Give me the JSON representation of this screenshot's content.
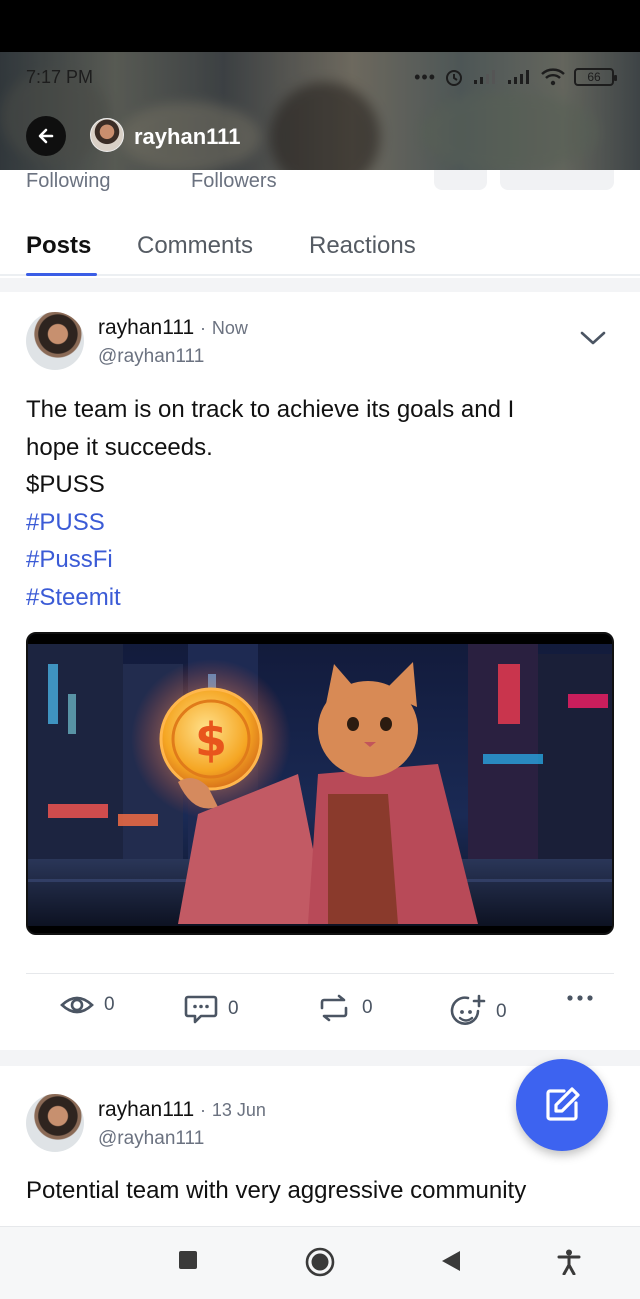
{
  "status_bar": {
    "time": "7:17 PM",
    "battery": "66"
  },
  "header": {
    "username": "rayhan111"
  },
  "profile_stats": {
    "following_label": "Following",
    "followers_label": "Followers"
  },
  "tabs": [
    {
      "label": "Posts",
      "active": true
    },
    {
      "label": "Comments",
      "active": false
    },
    {
      "label": "Reactions",
      "active": false
    }
  ],
  "posts": [
    {
      "author": "rayhan111",
      "separator": "·",
      "time": "Now",
      "handle": "@rayhan111",
      "text_lines": [
        "The team is on track to achieve its goals and I",
        "hope it succeeds.",
        "$PUSS"
      ],
      "tags": [
        "#PUSS",
        "#PussFi",
        "#Steemit"
      ],
      "stats": {
        "views": "0",
        "comments": "0",
        "reposts": "0",
        "reactions": "0"
      }
    },
    {
      "author": "rayhan111",
      "separator": "·",
      "time": "13 Jun",
      "handle": "@rayhan111",
      "text_lines": [
        "Potential team with very aggressive community"
      ]
    }
  ],
  "colors": {
    "accent": "#3b5ee6",
    "hashtag": "#3b5bd6",
    "fab": "#3d63f0"
  }
}
